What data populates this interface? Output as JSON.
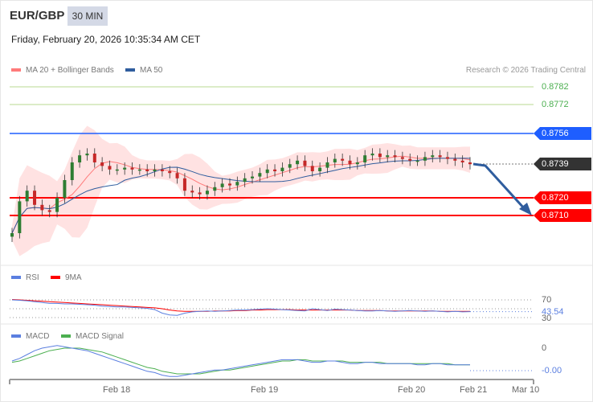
{
  "header": {
    "pair": "EUR/GBP",
    "timeframe": "30 MIN",
    "datetime": "Friday, February 20, 2026 10:35:34 AM CET"
  },
  "legend": {
    "ma20": "MA 20 + Bollinger Bands",
    "ma50": "MA 50",
    "credit": "Research © 2026 Trading Central"
  },
  "colors": {
    "ma20": "#ff7a7a",
    "ma50": "#2f5d9e",
    "support": "#ff0000",
    "resistance": "#1e5eff",
    "target": "#7cb342",
    "up": "#2e7d32",
    "down": "#c62828"
  },
  "levels": [
    {
      "value": "0.8782",
      "type": "target"
    },
    {
      "value": "0.8772",
      "type": "target"
    },
    {
      "value": "0.8756",
      "type": "resistance"
    },
    {
      "value": "0.8739",
      "type": "last"
    },
    {
      "value": "0.8720",
      "type": "support"
    },
    {
      "value": "0.8710",
      "type": "support"
    }
  ],
  "rsi": {
    "legend": "RSI",
    "signal_legend": "9MA",
    "level_70": "70",
    "level_30": "30",
    "value": "43.54"
  },
  "macd": {
    "legend": "MACD",
    "signal_legend": "MACD Signal",
    "zero": "0",
    "value": "-0.00"
  },
  "xaxis": [
    "Feb 18",
    "Feb 19",
    "Feb 20",
    "Feb 21",
    "Mar 10"
  ],
  "chart_data": {
    "type": "candlestick",
    "closes": [
      0.87,
      0.8718,
      0.8724,
      0.8716,
      0.8713,
      0.8712,
      0.872,
      0.873,
      0.874,
      0.8744,
      0.8745,
      0.874,
      0.8738,
      0.8736,
      0.8736,
      0.8737,
      0.8736,
      0.8736,
      0.8735,
      0.8736,
      0.8735,
      0.8734,
      0.8731,
      0.8724,
      0.8723,
      0.8722,
      0.8724,
      0.8726,
      0.8728,
      0.8727,
      0.8729,
      0.8731,
      0.8732,
      0.8734,
      0.8736,
      0.8735,
      0.8737,
      0.8739,
      0.8741,
      0.8738,
      0.8735,
      0.8737,
      0.874,
      0.8742,
      0.8741,
      0.8739,
      0.874,
      0.8744,
      0.8745,
      0.8743,
      0.8744,
      0.8743,
      0.8742,
      0.8741,
      0.8741,
      0.8743,
      0.8744,
      0.8743,
      0.8742,
      0.8741,
      0.874,
      0.8739
    ],
    "rsi": [
      70,
      69,
      68,
      66,
      64,
      62,
      62,
      61,
      61,
      60,
      59,
      58,
      56,
      55,
      54,
      54,
      53,
      52,
      51,
      48,
      40,
      36,
      35,
      40,
      43,
      44,
      45,
      44,
      45,
      46,
      47,
      47,
      48,
      49,
      50,
      49,
      48,
      47,
      46,
      45,
      50,
      48,
      46,
      49,
      48,
      47,
      46,
      45,
      45,
      46,
      45,
      44,
      45,
      46,
      45,
      44,
      45,
      44,
      43,
      44,
      43,
      43.5
    ],
    "rsi_ma": [
      71,
      70,
      69,
      68,
      67,
      66,
      65,
      64,
      63,
      62,
      61,
      60,
      59,
      58,
      57,
      56,
      55,
      54,
      53,
      52,
      50,
      47,
      45,
      44,
      44,
      44,
      44,
      45,
      45,
      45,
      46,
      46,
      47,
      47,
      48,
      48,
      48,
      48,
      47,
      47,
      47,
      47,
      47,
      47,
      47,
      47,
      46,
      46,
      46,
      46,
      45,
      45,
      45,
      45,
      45,
      45,
      45,
      44,
      44,
      44,
      44,
      44
    ],
    "macd": [
      0,
      2,
      5,
      8,
      10,
      11,
      12,
      11,
      10,
      9,
      8,
      6,
      4,
      2,
      0,
      -2,
      -4,
      -6,
      -8,
      -9,
      -11,
      -12,
      -12,
      -11,
      -10,
      -9,
      -8,
      -7,
      -7,
      -6,
      -5,
      -4,
      -3,
      -2,
      -1,
      0,
      1,
      1,
      1,
      0,
      -1,
      -1,
      0,
      0,
      -1,
      -2,
      -2,
      -1,
      -1,
      -2,
      -2,
      -2,
      -2,
      -2,
      -3,
      -3,
      -2,
      -2,
      -3,
      -3,
      -3,
      -3
    ],
    "macd_signal": [
      -1,
      0,
      2,
      4,
      6,
      8,
      9,
      10,
      10,
      10,
      9,
      8,
      7,
      5,
      3,
      1,
      -1,
      -3,
      -5,
      -6,
      -8,
      -9,
      -10,
      -10,
      -10,
      -10,
      -9,
      -8,
      -7,
      -7,
      -6,
      -5,
      -4,
      -3,
      -2,
      -1,
      0,
      0,
      1,
      1,
      0,
      0,
      0,
      0,
      0,
      -1,
      -1,
      -1,
      -1,
      -1,
      -2,
      -2,
      -2,
      -2,
      -2,
      -2,
      -2,
      -2,
      -2,
      -3,
      -3,
      -3
    ]
  }
}
